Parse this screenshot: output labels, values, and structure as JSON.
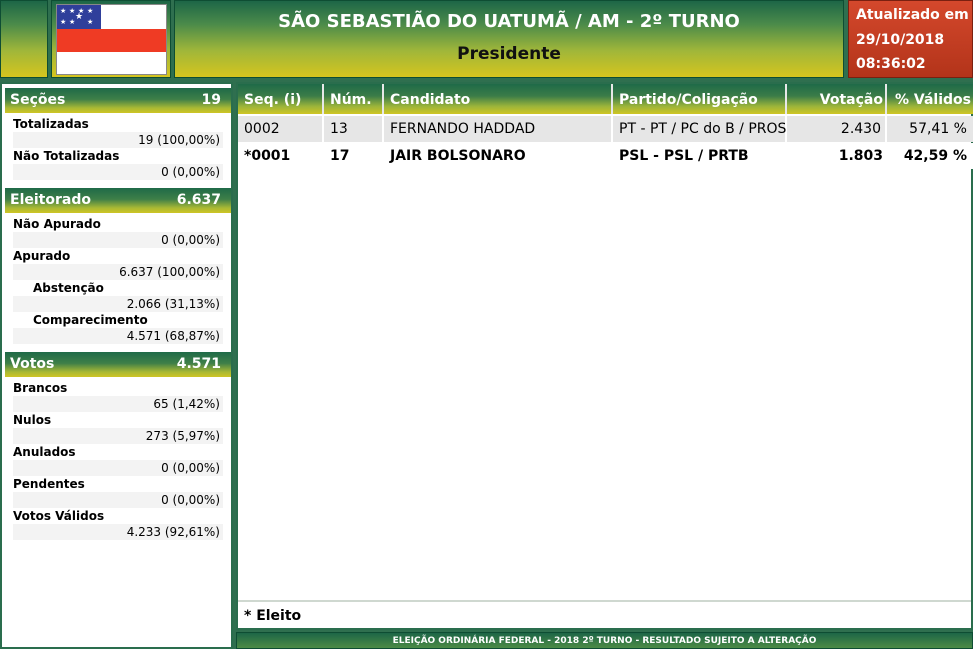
{
  "header": {
    "title": "SÃO SEBASTIÃO DO UATUMÃ / AM - 2º TURNO",
    "subtitle": "Presidente",
    "updated_label": "Atualizado em",
    "updated_date": "29/10/2018",
    "updated_time": "08:36:02",
    "flag_icon": "amazonas-flag-icon"
  },
  "secoes": {
    "label": "Seções",
    "value": "19",
    "items": [
      {
        "label": "Totalizadas",
        "value": "19 (100,00%)"
      },
      {
        "label": "Não Totalizadas",
        "value": "0 (0,00%)"
      }
    ]
  },
  "eleitorado": {
    "label": "Eleitorado",
    "value": "6.637",
    "items": [
      {
        "label": "Não Apurado",
        "value": "0 (0,00%)"
      },
      {
        "label": "Apurado",
        "value": "6.637 (100,00%)"
      },
      {
        "label": "Abstenção",
        "value": "2.066 (31,13%)"
      },
      {
        "label": "Comparecimento",
        "value": "4.571 (68,87%)"
      }
    ]
  },
  "votos": {
    "label": "Votos",
    "value": "4.571",
    "items": [
      {
        "label": "Brancos",
        "value": "65 (1,42%)"
      },
      {
        "label": "Nulos",
        "value": "273 (5,97%)"
      },
      {
        "label": "Anulados",
        "value": "0 (0,00%)"
      },
      {
        "label": "Pendentes",
        "value": "0 (0,00%)"
      },
      {
        "label": "Votos Válidos",
        "value": "4.233 (92,61%)"
      }
    ]
  },
  "table": {
    "columns": [
      "Seq.   (i)",
      "Núm.",
      "Candidato",
      "Partido/Coligação",
      "Votação",
      "% Válidos"
    ],
    "rows": [
      {
        "seq": "0002",
        "num": "13",
        "candidato": "FERNANDO HADDAD",
        "partido": "PT - PT / PC do B / PROS",
        "votacao": "2.430",
        "validos": "57,41 %"
      },
      {
        "seq": "*0001",
        "num": "17",
        "candidato": "JAIR BOLSONARO",
        "partido": "PSL - PSL / PRTB",
        "votacao": "1.803",
        "validos": "42,59 %"
      }
    ],
    "legend": "* Eleito"
  },
  "footer": "ELEIÇÃO ORDINÁRIA FEDERAL - 2018 2º TURNO - RESULTADO SUJEITO A ALTERAÇÃO"
}
